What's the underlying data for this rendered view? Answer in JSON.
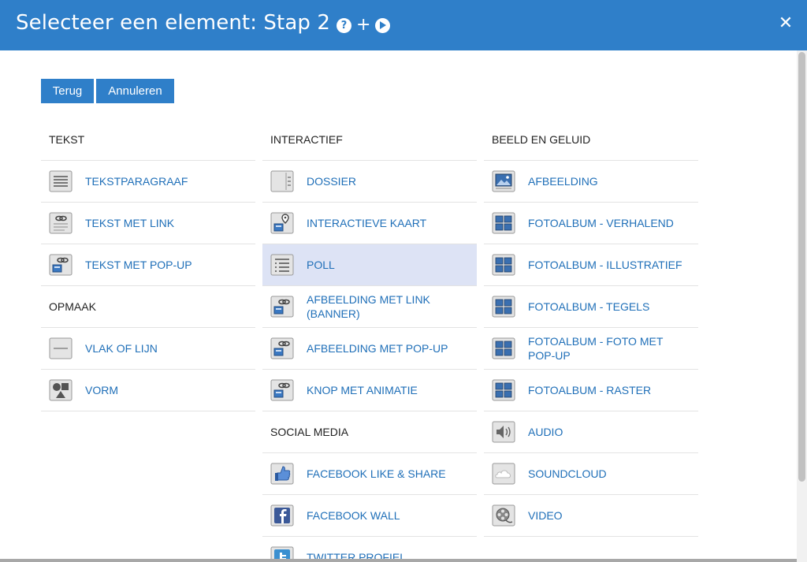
{
  "header": {
    "title": "Selecteer een element: Stap 2",
    "help_glyph": "?",
    "plus": "+",
    "close_glyph": "✕"
  },
  "buttons": {
    "back": "Terug",
    "cancel": "Annuleren"
  },
  "columns": {
    "col1": {
      "heading": "TEKST",
      "items": [
        {
          "label": "TEKSTPARAGRAAF",
          "icon": "text-paragraph-icon"
        },
        {
          "label": "TEKST MET LINK",
          "icon": "text-link-icon"
        },
        {
          "label": "TEKST MET POP-UP",
          "icon": "text-popup-icon"
        }
      ],
      "heading2": "OPMAAK",
      "items2": [
        {
          "label": "VLAK OF LIJN",
          "icon": "line-block-icon"
        },
        {
          "label": "VORM",
          "icon": "shape-icon"
        }
      ]
    },
    "col2": {
      "heading": "INTERACTIEF",
      "items": [
        {
          "label": "DOSSIER",
          "icon": "dossier-icon"
        },
        {
          "label": "INTERACTIEVE KAART",
          "icon": "map-pin-icon"
        },
        {
          "label": "POLL",
          "icon": "poll-icon"
        },
        {
          "label": "AFBEELDING MET LINK (BANNER)",
          "icon": "image-link-icon"
        },
        {
          "label": "AFBEELDING MET POP-UP",
          "icon": "image-popup-icon"
        },
        {
          "label": "KNOP MET ANIMATIE",
          "icon": "animated-button-icon"
        }
      ],
      "heading2": "SOCIAL MEDIA",
      "items2": [
        {
          "label": "FACEBOOK LIKE & SHARE",
          "icon": "thumbs-up-icon"
        },
        {
          "label": "FACEBOOK WALL",
          "icon": "facebook-icon"
        },
        {
          "label": "TWITTER PROFIEL",
          "icon": "twitter-icon"
        }
      ]
    },
    "col3": {
      "heading": "BEELD EN GELUID",
      "items": [
        {
          "label": "AFBEELDING",
          "icon": "image-icon"
        },
        {
          "label": "FOTOALBUM - VERHALEND",
          "icon": "photo-album-icon"
        },
        {
          "label": "FOTOALBUM - ILLUSTRATIEF",
          "icon": "photo-album-icon"
        },
        {
          "label": "FOTOALBUM - TEGELS",
          "icon": "photo-album-icon"
        },
        {
          "label": "FOTOALBUM - FOTO MET POP-UP",
          "icon": "photo-album-icon"
        },
        {
          "label": "FOTOALBUM - RASTER",
          "icon": "photo-album-icon"
        },
        {
          "label": "AUDIO",
          "icon": "speaker-icon"
        },
        {
          "label": "SOUNDCLOUD",
          "icon": "cloud-icon"
        },
        {
          "label": "VIDEO",
          "icon": "film-reel-icon"
        }
      ]
    }
  },
  "selected_item": "POLL",
  "colors": {
    "accent": "#2f7fc9",
    "link": "#1f6fb8",
    "selected_bg": "#dde3f5"
  }
}
